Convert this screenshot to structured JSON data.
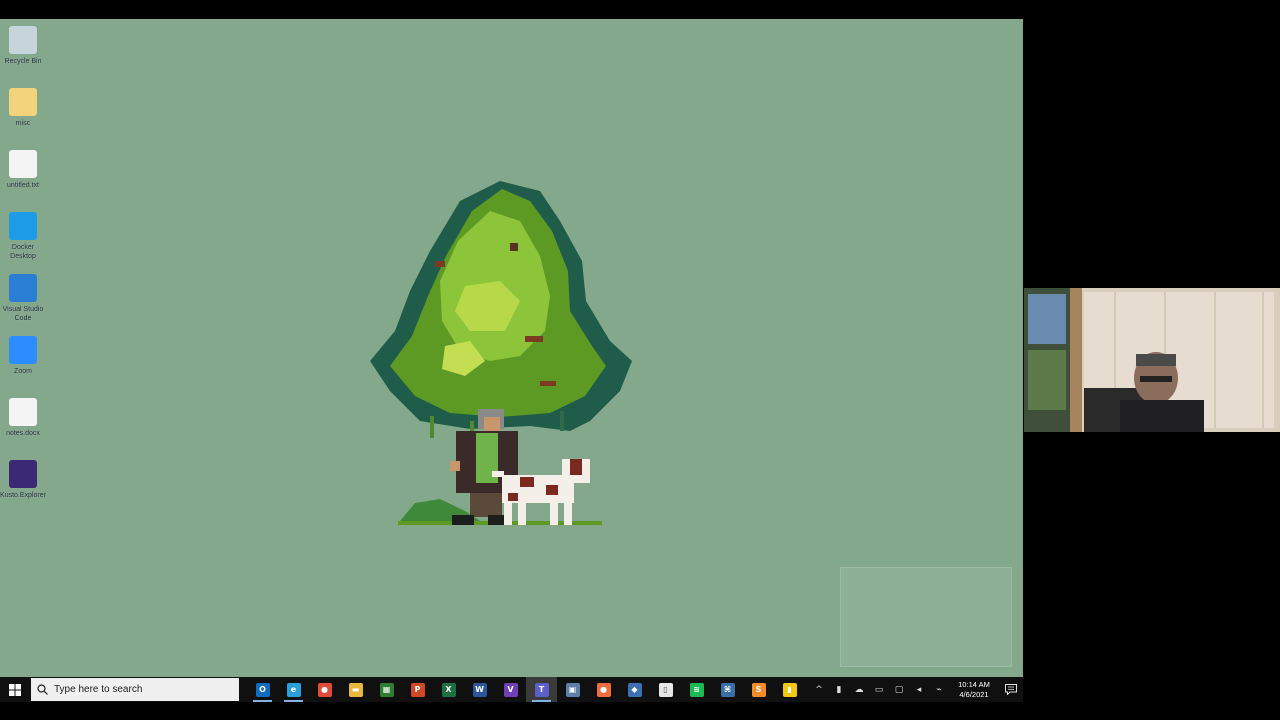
{
  "desktop": {
    "background_color": "#84a88c",
    "icons": [
      {
        "name": "desktop-icon-recycle-bin",
        "label": "Recycle Bin",
        "icon": "recycle-bin-icon",
        "color": "#c8d4dc"
      },
      {
        "name": "desktop-icon-misc",
        "label": "misc",
        "icon": "folder-icon",
        "color": "#f2d27a"
      },
      {
        "name": "desktop-icon-document",
        "label": "untitled.txt",
        "icon": "document-icon",
        "color": "#f4f4f4"
      },
      {
        "name": "desktop-icon-docker",
        "label": "Docker Desktop",
        "icon": "docker-icon",
        "color": "#1d9be6"
      },
      {
        "name": "desktop-icon-vscode",
        "label": "Visual Studio Code",
        "icon": "vscode-icon",
        "color": "#2a7fd4"
      },
      {
        "name": "desktop-icon-zoom",
        "label": "Zoom",
        "icon": "zoom-icon",
        "color": "#2d8cff"
      },
      {
        "name": "desktop-icon-notes",
        "label": "notes.docx",
        "icon": "document-icon",
        "color": "#f4f4f4"
      },
      {
        "name": "desktop-icon-kusto",
        "label": "Kusto.Explorer",
        "icon": "kusto-icon",
        "color": "#3b2a73"
      }
    ]
  },
  "taskbar": {
    "search_placeholder": "Type here to search",
    "apps": [
      {
        "name": "taskbar-outlook",
        "icon": "outlook-icon",
        "glyph": "O",
        "color": "#0f6cbd",
        "active": true
      },
      {
        "name": "taskbar-edge",
        "icon": "edge-icon",
        "glyph": "e",
        "color": "#2a9fd8",
        "active": true
      },
      {
        "name": "taskbar-chrome",
        "icon": "chrome-icon",
        "glyph": "●",
        "color": "#e04b3a",
        "active": false
      },
      {
        "name": "taskbar-file-explorer",
        "icon": "folder-icon",
        "glyph": "▬",
        "color": "#e8b73c",
        "active": false
      },
      {
        "name": "taskbar-excel-green",
        "icon": "spreadsheet-icon",
        "glyph": "▦",
        "color": "#2e7d32",
        "active": false
      },
      {
        "name": "taskbar-powerpoint",
        "icon": "powerpoint-icon",
        "glyph": "P",
        "color": "#d24726",
        "active": false
      },
      {
        "name": "taskbar-excel",
        "icon": "excel-icon",
        "glyph": "X",
        "color": "#1d6f42",
        "active": false
      },
      {
        "name": "taskbar-word",
        "icon": "word-icon",
        "glyph": "W",
        "color": "#2b579a",
        "active": false
      },
      {
        "name": "taskbar-visual-studio",
        "icon": "visual-studio-icon",
        "glyph": "V",
        "color": "#6f3fb5",
        "active": false
      },
      {
        "name": "taskbar-teams",
        "icon": "teams-icon",
        "glyph": "T",
        "color": "#5b5fc7",
        "active": true,
        "highlight": true
      },
      {
        "name": "taskbar-remote-desktop",
        "icon": "remote-desktop-icon",
        "glyph": "▣",
        "color": "#5b7fa8",
        "active": false
      },
      {
        "name": "taskbar-postman",
        "icon": "postman-icon",
        "glyph": "●",
        "color": "#f26b3a",
        "active": false
      },
      {
        "name": "taskbar-security",
        "icon": "shield-icon",
        "glyph": "◆",
        "color": "#3d6fb3",
        "active": false
      },
      {
        "name": "taskbar-notepad",
        "icon": "notepad-icon",
        "glyph": "▯",
        "color": "#e8e8e8",
        "active": false
      },
      {
        "name": "taskbar-spotify",
        "icon": "spotify-icon",
        "glyph": "≋",
        "color": "#1db954",
        "active": false
      },
      {
        "name": "taskbar-network-tool",
        "icon": "network-icon",
        "glyph": "⌘",
        "color": "#3a6ea5",
        "active": false
      },
      {
        "name": "taskbar-sublime",
        "icon": "sublime-icon",
        "glyph": "S",
        "color": "#f28c28",
        "active": false
      },
      {
        "name": "taskbar-power-bi",
        "icon": "power-bi-icon",
        "glyph": "▮",
        "color": "#f2c811",
        "active": false
      }
    ],
    "tray": [
      {
        "name": "tray-chevron-up",
        "icon": "chevron-up-icon",
        "glyph": "^"
      },
      {
        "name": "tray-microphone",
        "icon": "microphone-icon",
        "glyph": "▮"
      },
      {
        "name": "tray-onedrive",
        "icon": "cloud-icon",
        "glyph": "☁"
      },
      {
        "name": "tray-battery",
        "icon": "battery-icon",
        "glyph": "▭"
      },
      {
        "name": "tray-display",
        "icon": "display-icon",
        "glyph": "▢"
      },
      {
        "name": "tray-volume",
        "icon": "volume-icon",
        "glyph": "◂"
      },
      {
        "name": "tray-network",
        "icon": "network-icon",
        "glyph": "⌁"
      }
    ],
    "time": "10:14 AM",
    "date": "4/6/2021"
  }
}
